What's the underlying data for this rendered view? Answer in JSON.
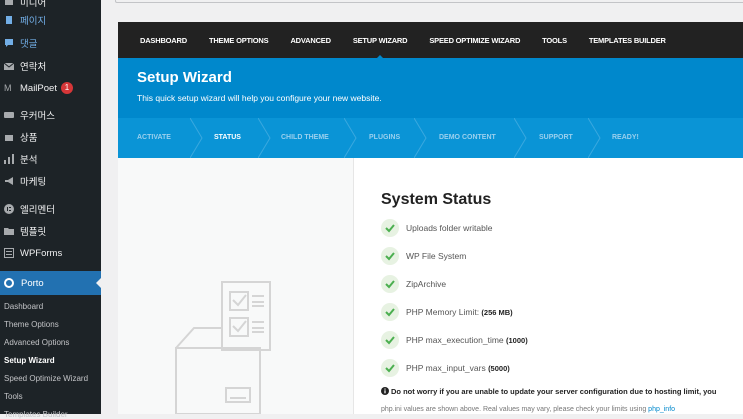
{
  "sidebar": {
    "items": [
      {
        "label": "미디어",
        "icon": "media-icon"
      },
      {
        "label": "페이지",
        "icon": "pages-icon"
      },
      {
        "label": "댓글",
        "icon": "comments-icon"
      },
      {
        "label": "연락처",
        "icon": "contact-icon"
      },
      {
        "label": "MailPoet",
        "icon": "mailpoet-icon",
        "badge": "1"
      },
      {
        "label": "우커머스",
        "icon": "woocommerce-icon"
      },
      {
        "label": "상품",
        "icon": "products-icon"
      },
      {
        "label": "분석",
        "icon": "analytics-icon"
      },
      {
        "label": "마케팅",
        "icon": "marketing-icon"
      },
      {
        "label": "엘리멘터",
        "icon": "elementor-icon"
      },
      {
        "label": "템플릿",
        "icon": "templates-icon"
      },
      {
        "label": "WPForms",
        "icon": "wpforms-icon"
      }
    ],
    "active": {
      "label": "Porto",
      "icon": "porto-icon"
    },
    "submenu": [
      "Dashboard",
      "Theme Options",
      "Advanced Options",
      "Setup Wizard",
      "Speed Optimize Wizard",
      "Tools",
      "Templates Builder"
    ],
    "current_submenu": "Setup Wizard"
  },
  "nav": {
    "tabs": [
      "DASHBOARD",
      "THEME OPTIONS",
      "ADVANCED",
      "SETUP WIZARD",
      "SPEED OPTIMIZE WIZARD",
      "TOOLS",
      "TEMPLATES BUILDER"
    ],
    "active": "SETUP WIZARD"
  },
  "header": {
    "title": "Setup Wizard",
    "subtitle": "This quick setup wizard will help you configure your new website."
  },
  "steps": [
    "ACTIVATE",
    "STATUS",
    "CHILD THEME",
    "PLUGINS",
    "DEMO CONTENT",
    "SUPPORT",
    "READY!"
  ],
  "current_step": "STATUS",
  "status": {
    "title": "System Status",
    "checks": [
      {
        "label": "Uploads folder writable",
        "value": ""
      },
      {
        "label": "WP File System",
        "value": ""
      },
      {
        "label": "ZipArchive",
        "value": ""
      },
      {
        "label": "PHP Memory Limit: ",
        "value": "(256 MB)"
      },
      {
        "label": "PHP max_execution_time ",
        "value": "(1000)"
      },
      {
        "label": "PHP max_input_vars ",
        "value": "(5000)"
      }
    ],
    "note": "Do not worry if you are unable to update your server configuration due to hosting limit, you",
    "note2": "php.ini values are shown above. Real values may vary, please check your limits using ",
    "note2_link": "php_info"
  },
  "colors": {
    "sidebar_bg": "#1d2327",
    "accent": "#0088cc",
    "nav_bg": "#222222",
    "check": "#4caf50"
  }
}
